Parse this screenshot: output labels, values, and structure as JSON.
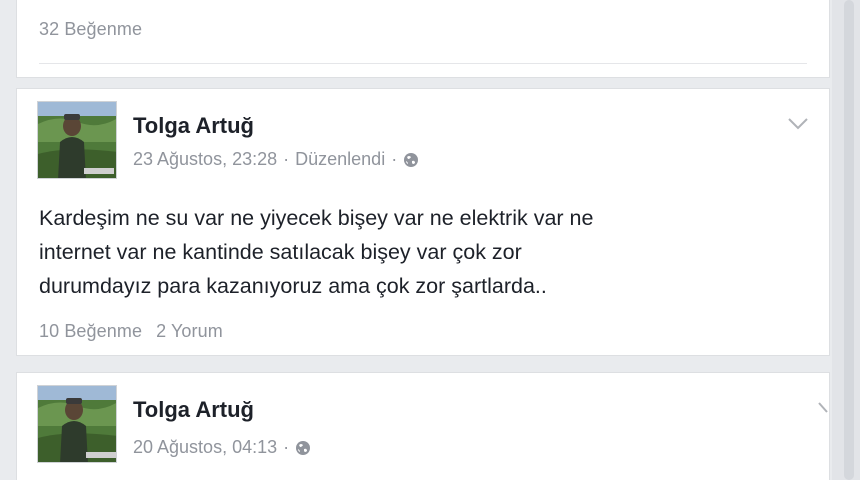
{
  "previous_post": {
    "likes": "32 Beğenme"
  },
  "posts": [
    {
      "author": "Tolga Artuğ",
      "date": "23 Ağustos, 23:28",
      "separator": "·",
      "edited": "Düzenlendi",
      "privacy_icon": "globe-icon",
      "text_lines": [
        "Kardeşim ne su var ne yiyecek bişey var ne elektrik var ne",
        "internet var ne kantinde satılacak bişey var çok zor",
        "durumdayız para kazanıyoruz ama çok zor şartlarda.."
      ],
      "likes": "10 Beğenme",
      "comments": "2 Yorum"
    },
    {
      "author": "Tolga Artuğ",
      "date": "20 Ağustos, 04:13",
      "separator": "·",
      "privacy_icon": "globe-icon"
    }
  ],
  "colors": {
    "background": "#e9ebee",
    "card": "#ffffff",
    "text": "#1d2129",
    "muted": "#90949c"
  }
}
